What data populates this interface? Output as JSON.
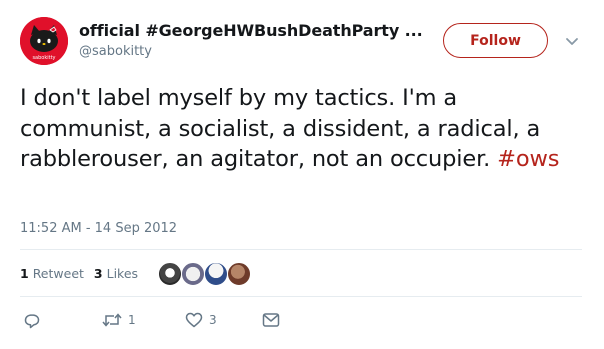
{
  "user": {
    "name": "official #GeorgeHWBushDeathParty ...",
    "handle": "@sabokitty",
    "avatar_text": "sabokitty"
  },
  "follow": {
    "label": "Follow"
  },
  "tweet": {
    "text": "I don't label myself by my tactics. I'm a communist, a socialist, a dissident, a radical, a rabblerouser, an agitator, not an occupier.",
    "hashtag": "#ows",
    "timestamp": "11:52 AM - 14 Sep 2012"
  },
  "stats": {
    "retweets_count": "1",
    "retweets_label": "Retweet",
    "likes_count": "3",
    "likes_label": "Likes"
  },
  "actions": {
    "retweet_count": "1",
    "like_count": "3"
  },
  "colors": {
    "accent": "#b5241c",
    "muted": "#657786",
    "text": "#14171a",
    "divider": "#e6ecf0"
  },
  "icons": [
    "reply-icon",
    "retweet-icon",
    "heart-icon",
    "message-icon",
    "chevron-down-icon"
  ]
}
